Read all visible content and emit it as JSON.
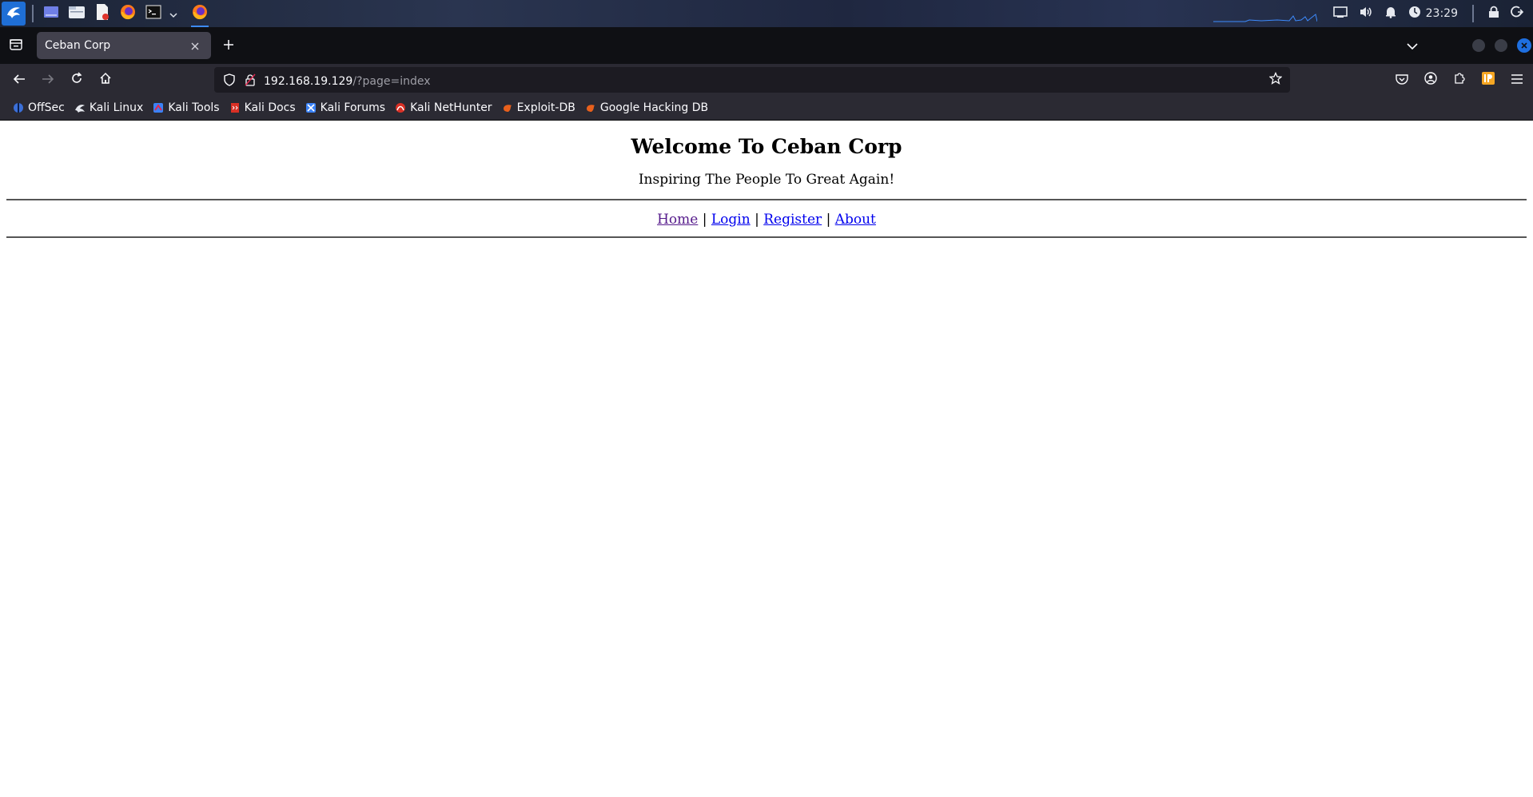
{
  "os_panel": {
    "clock": "23:29",
    "apps": [
      "kali-menu",
      "workspace",
      "file-manager",
      "text-editor",
      "firefox",
      "terminal",
      "terminal-dropdown",
      "firefox-active"
    ]
  },
  "browser": {
    "tab": {
      "title": "Ceban Corp"
    },
    "url": {
      "host": "192.168.19.129",
      "path": "/?page=index"
    },
    "bookmarks": [
      {
        "label": "OffSec",
        "icon": "offsec-icon",
        "color": "#3b6fd8"
      },
      {
        "label": "Kali Linux",
        "icon": "kali-dragon-icon",
        "color": "#ffffff"
      },
      {
        "label": "Kali Tools",
        "icon": "kali-tools-icon",
        "color": "#3b82f6"
      },
      {
        "label": "Kali Docs",
        "icon": "kali-docs-icon",
        "color": "#d93025"
      },
      {
        "label": "Kali Forums",
        "icon": "kali-forums-icon",
        "color": "#3b82f6"
      },
      {
        "label": "Kali NetHunter",
        "icon": "nethunter-icon",
        "color": "#d93025"
      },
      {
        "label": "Exploit-DB",
        "icon": "exploit-db-icon",
        "color": "#e8601c"
      },
      {
        "label": "Google Hacking DB",
        "icon": "ghdb-icon",
        "color": "#e8601c"
      }
    ]
  },
  "page": {
    "heading": "Welcome To Ceban Corp",
    "tagline": "Inspiring The People To Great Again!",
    "menu": {
      "home": "Home",
      "login": "Login",
      "register": "Register",
      "about": "About",
      "separator": " | "
    }
  }
}
